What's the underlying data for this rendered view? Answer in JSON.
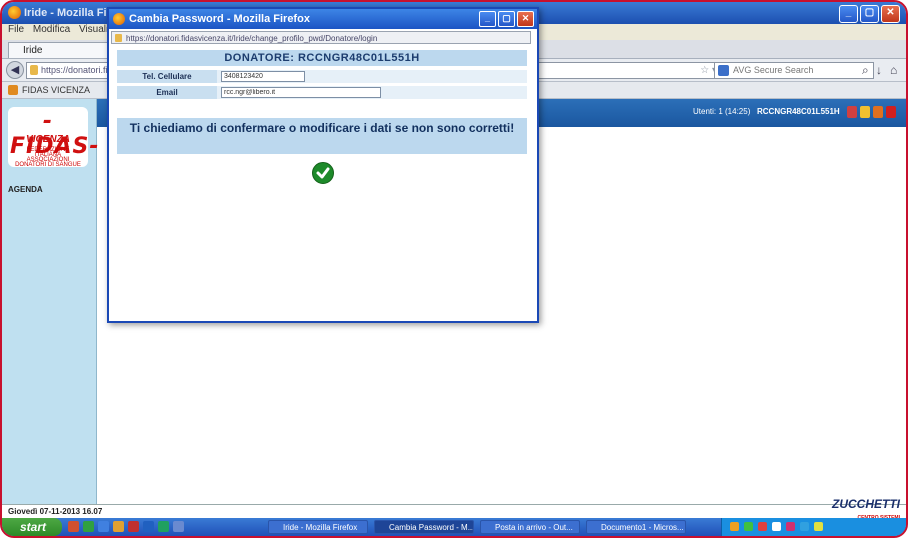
{
  "browser": {
    "title": "Iride - Mozilla Firefox",
    "menu": [
      "File",
      "Modifica",
      "Visualizza"
    ],
    "tab_label": "Iride",
    "url": "https://donatori.fidasvicenza.it/",
    "search_placeholder": "AVG Secure Search",
    "bookmark": "FIDAS VICENZA"
  },
  "app": {
    "logo_text": "-FIDAS-",
    "logo_sub": "VICENZA",
    "logo_small": "FEDERAZIONE ITALIANA ASSOCIAZIONI DONATORI DI SANGUE",
    "nav_item": "AGENDA",
    "user_status": "Utenti: 1 (14:25)",
    "user_name": "RCCNGR48C01L551H",
    "status_date": "Giovedì 07-11-2013 16.07",
    "footer_logo": "ZUCCHETTI",
    "footer_logo_sub": "CENTRO SISTEMI"
  },
  "popup": {
    "title": "Cambia Password - Mozilla Firefox",
    "url": "https://donatori.fidasvicenza.it/Iride/change_profilo_pwd/Donatore/login",
    "donor_header": "DONATORE: RCCNGR48C01L551H",
    "fields": [
      {
        "label": "Tel. Cellulare",
        "value": "3408123420"
      },
      {
        "label": "Email",
        "value": "rcc.ngr@libero.it"
      }
    ],
    "message": "Ti chiediamo di confermare o modificare i dati se non sono corretti!"
  },
  "taskbar": {
    "start_label": "start",
    "tasks": [
      "Iride - Mozilla Firefox",
      "Cambia Password - M...",
      "Posta in arrivo - Out...",
      "Documento1 - Micros..."
    ],
    "colors": {
      "start": "#3a9a34",
      "bar": "#2457c8"
    }
  }
}
